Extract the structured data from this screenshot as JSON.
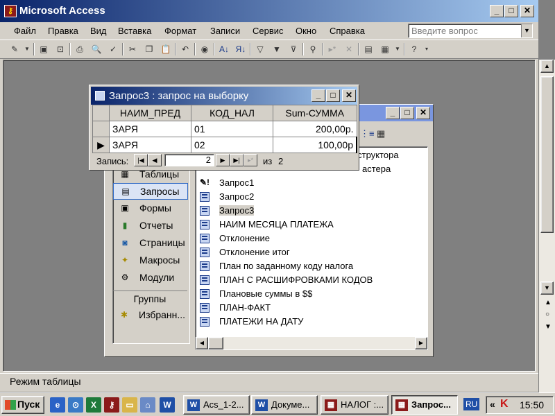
{
  "app": {
    "title": "Microsoft Access",
    "menu": [
      "Файл",
      "Правка",
      "Вид",
      "Вставка",
      "Формат",
      "Записи",
      "Сервис",
      "Окно",
      "Справка"
    ],
    "ask_placeholder": "Введите вопрос",
    "status": "Режим таблицы"
  },
  "query_window": {
    "title": "Запрос3 : запрос на выборку",
    "columns": [
      "НАИМ_ПРЕД",
      "КОД_НАЛ",
      "Sum-СУММА"
    ],
    "rows": [
      [
        "ЗАРЯ",
        "01",
        "200,00р."
      ],
      [
        "ЗАРЯ",
        "02",
        "100,00р"
      ]
    ],
    "nav": {
      "record_label": "Запись:",
      "current": "2",
      "of_label": "из",
      "total": "2"
    }
  },
  "db_window": {
    "objects": [
      {
        "label": "Таблицы",
        "icon": "table-icon"
      },
      {
        "label": "Запросы",
        "icon": "query-icon",
        "selected": true
      },
      {
        "label": "Формы",
        "icon": "form-icon"
      },
      {
        "label": "Отчеты",
        "icon": "report-icon"
      },
      {
        "label": "Страницы",
        "icon": "page-icon"
      },
      {
        "label": "Макросы",
        "icon": "macro-icon"
      },
      {
        "label": "Модули",
        "icon": "module-icon"
      }
    ],
    "groups_label": "Группы",
    "favorites_label": "Избранн...",
    "items": [
      "Создание запроса в режиме конструктора",
      "Создание запроса с помощью мастера",
      "Запрос1",
      "Запрос2",
      "Запрос3",
      "НАИМ МЕСЯЦА ПЛАТЕЖА",
      "Отклонение",
      "Отклонение итог",
      "План по заданному коду налога",
      "ПЛАН С РАСШИФРОВКАМИ КОДОВ",
      "Плановые суммы в $$",
      "ПЛАН-ФАКТ",
      "ПЛАТЕЖИ НА ДАТУ"
    ],
    "visible_items_top": [
      "нструктора",
      "астера"
    ],
    "selected_item": "Запрос3"
  },
  "taskbar": {
    "start_label": "Пуск",
    "tasks": [
      {
        "label": "Acs_1-2...",
        "icon": "W"
      },
      {
        "label": "Докуме...",
        "icon": "W"
      },
      {
        "label": "НАЛОГ :...",
        "icon": "▦"
      },
      {
        "label": "Запрос...",
        "icon": "▦",
        "active": true
      }
    ],
    "lang": "RU",
    "clock": "15:50"
  },
  "colors": {
    "title_active": "#0a246a",
    "title_inactive": "#7a96df",
    "face": "#d4d0c8"
  }
}
